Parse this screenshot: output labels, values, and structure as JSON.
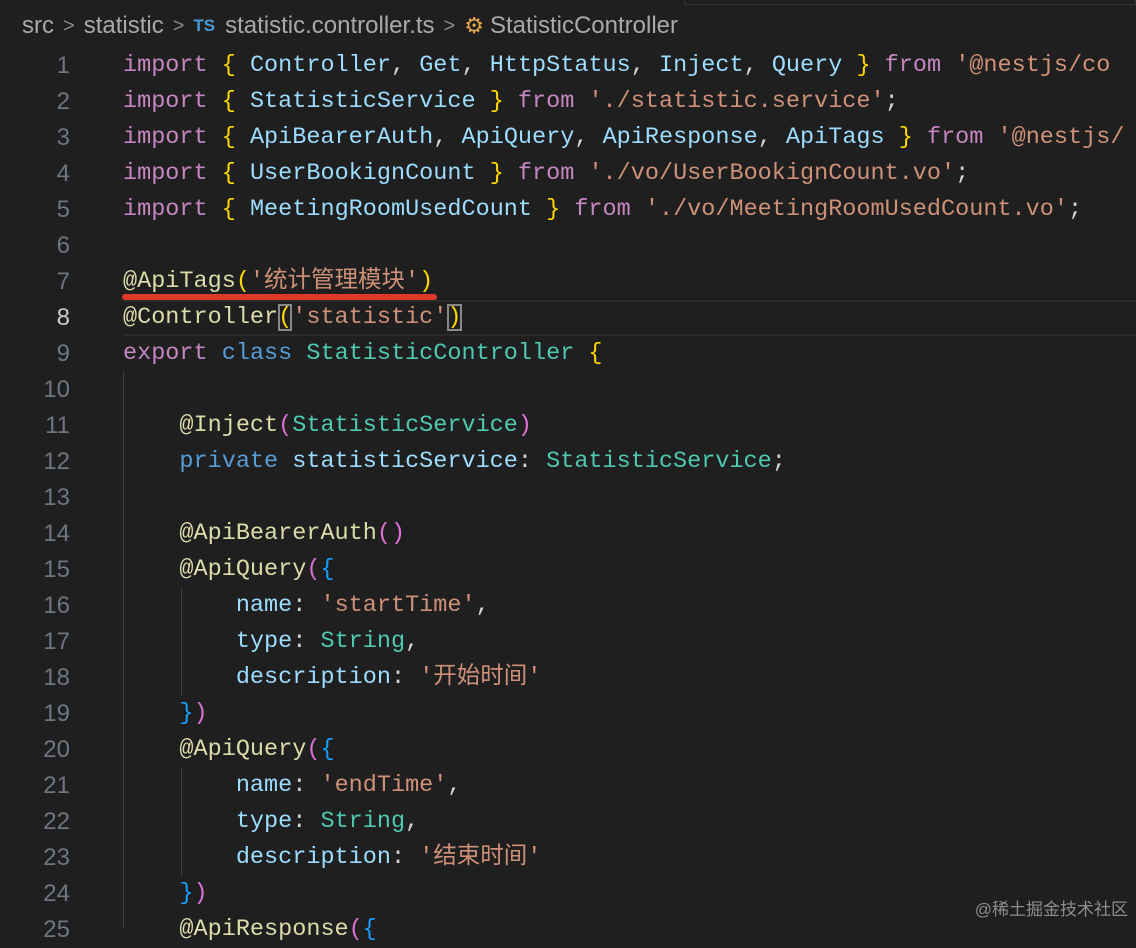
{
  "breadcrumb": {
    "items": [
      "src",
      "statistic",
      "statistic.controller.ts",
      "StatisticController"
    ],
    "file_badge": "TS"
  },
  "active_line": 8,
  "lines": [
    [
      [
        "kw",
        "import"
      ],
      [
        "pl",
        " "
      ],
      [
        "br1",
        "{"
      ],
      [
        "pl",
        " "
      ],
      [
        "var",
        "Controller"
      ],
      [
        "pl",
        ", "
      ],
      [
        "var",
        "Get"
      ],
      [
        "pl",
        ", "
      ],
      [
        "var",
        "HttpStatus"
      ],
      [
        "pl",
        ", "
      ],
      [
        "var",
        "Inject"
      ],
      [
        "pl",
        ", "
      ],
      [
        "var",
        "Query"
      ],
      [
        "pl",
        " "
      ],
      [
        "br1",
        "}"
      ],
      [
        "pl",
        " "
      ],
      [
        "kw",
        "from"
      ],
      [
        "pl",
        " "
      ],
      [
        "str",
        "'@nestjs/co"
      ]
    ],
    [
      [
        "kw",
        "import"
      ],
      [
        "pl",
        " "
      ],
      [
        "br1",
        "{"
      ],
      [
        "pl",
        " "
      ],
      [
        "var",
        "StatisticService"
      ],
      [
        "pl",
        " "
      ],
      [
        "br1",
        "}"
      ],
      [
        "pl",
        " "
      ],
      [
        "kw",
        "from"
      ],
      [
        "pl",
        " "
      ],
      [
        "str",
        "'./statistic.service'"
      ],
      [
        "pl",
        ";"
      ]
    ],
    [
      [
        "kw",
        "import"
      ],
      [
        "pl",
        " "
      ],
      [
        "br1",
        "{"
      ],
      [
        "pl",
        " "
      ],
      [
        "var",
        "ApiBearerAuth"
      ],
      [
        "pl",
        ", "
      ],
      [
        "var",
        "ApiQuery"
      ],
      [
        "pl",
        ", "
      ],
      [
        "var",
        "ApiResponse"
      ],
      [
        "pl",
        ", "
      ],
      [
        "var",
        "ApiTags"
      ],
      [
        "pl",
        " "
      ],
      [
        "br1",
        "}"
      ],
      [
        "pl",
        " "
      ],
      [
        "kw",
        "from"
      ],
      [
        "pl",
        " "
      ],
      [
        "str",
        "'@nestjs/"
      ]
    ],
    [
      [
        "kw",
        "import"
      ],
      [
        "pl",
        " "
      ],
      [
        "br1",
        "{"
      ],
      [
        "pl",
        " "
      ],
      [
        "var",
        "UserBookignCount"
      ],
      [
        "pl",
        " "
      ],
      [
        "br1",
        "}"
      ],
      [
        "pl",
        " "
      ],
      [
        "kw",
        "from"
      ],
      [
        "pl",
        " "
      ],
      [
        "str",
        "'./vo/UserBookignCount.vo'"
      ],
      [
        "pl",
        ";"
      ]
    ],
    [
      [
        "kw",
        "import"
      ],
      [
        "pl",
        " "
      ],
      [
        "br1",
        "{"
      ],
      [
        "pl",
        " "
      ],
      [
        "var",
        "MeetingRoomUsedCount"
      ],
      [
        "pl",
        " "
      ],
      [
        "br1",
        "}"
      ],
      [
        "pl",
        " "
      ],
      [
        "kw",
        "from"
      ],
      [
        "pl",
        " "
      ],
      [
        "str",
        "'./vo/MeetingRoomUsedCount.vo'"
      ],
      [
        "pl",
        ";"
      ]
    ],
    [],
    [
      [
        "fn",
        "@ApiTags"
      ],
      [
        "br1",
        "("
      ],
      [
        "str",
        "'统计管理模块'"
      ],
      [
        "br1",
        ")"
      ]
    ],
    [
      [
        "fn",
        "@Controller"
      ],
      [
        "br1m",
        "("
      ],
      [
        "str",
        "'statistic'"
      ],
      [
        "br1m",
        ")"
      ]
    ],
    [
      [
        "kw",
        "export"
      ],
      [
        "pl",
        " "
      ],
      [
        "kw2",
        "class"
      ],
      [
        "pl",
        " "
      ],
      [
        "cls",
        "StatisticController"
      ],
      [
        "pl",
        " "
      ],
      [
        "br1",
        "{"
      ]
    ],
    [],
    [
      [
        "pl",
        "    "
      ],
      [
        "fn",
        "@Inject"
      ],
      [
        "br2",
        "("
      ],
      [
        "cls",
        "StatisticService"
      ],
      [
        "br2",
        ")"
      ]
    ],
    [
      [
        "pl",
        "    "
      ],
      [
        "kw2",
        "private"
      ],
      [
        "pl",
        " "
      ],
      [
        "var",
        "statisticService"
      ],
      [
        "pl",
        ": "
      ],
      [
        "cls",
        "StatisticService"
      ],
      [
        "pl",
        ";"
      ]
    ],
    [],
    [
      [
        "pl",
        "    "
      ],
      [
        "fn",
        "@ApiBearerAuth"
      ],
      [
        "br2",
        "()"
      ]
    ],
    [
      [
        "pl",
        "    "
      ],
      [
        "fn",
        "@ApiQuery"
      ],
      [
        "br2",
        "("
      ],
      [
        "br3",
        "{"
      ]
    ],
    [
      [
        "pl",
        "        "
      ],
      [
        "var",
        "name"
      ],
      [
        "pl",
        ": "
      ],
      [
        "str",
        "'startTime'"
      ],
      [
        "pl",
        ","
      ]
    ],
    [
      [
        "pl",
        "        "
      ],
      [
        "var",
        "type"
      ],
      [
        "pl",
        ": "
      ],
      [
        "cls",
        "String"
      ],
      [
        "pl",
        ","
      ]
    ],
    [
      [
        "pl",
        "        "
      ],
      [
        "var",
        "description"
      ],
      [
        "pl",
        ": "
      ],
      [
        "str",
        "'开始时间'"
      ]
    ],
    [
      [
        "pl",
        "    "
      ],
      [
        "br3",
        "}"
      ],
      [
        "br2",
        ")"
      ]
    ],
    [
      [
        "pl",
        "    "
      ],
      [
        "fn",
        "@ApiQuery"
      ],
      [
        "br2",
        "("
      ],
      [
        "br3",
        "{"
      ]
    ],
    [
      [
        "pl",
        "        "
      ],
      [
        "var",
        "name"
      ],
      [
        "pl",
        ": "
      ],
      [
        "str",
        "'endTime'"
      ],
      [
        "pl",
        ","
      ]
    ],
    [
      [
        "pl",
        "        "
      ],
      [
        "var",
        "type"
      ],
      [
        "pl",
        ": "
      ],
      [
        "cls",
        "String"
      ],
      [
        "pl",
        ","
      ]
    ],
    [
      [
        "pl",
        "        "
      ],
      [
        "var",
        "description"
      ],
      [
        "pl",
        ": "
      ],
      [
        "str",
        "'结束时间'"
      ]
    ],
    [
      [
        "pl",
        "    "
      ],
      [
        "br3",
        "}"
      ],
      [
        "br2",
        ")"
      ]
    ],
    [
      [
        "pl",
        "    "
      ],
      [
        "fn",
        "@ApiResponse"
      ],
      [
        "br2",
        "("
      ],
      [
        "br3",
        "{"
      ]
    ]
  ],
  "watermark": "@稀土掘金技术社区",
  "colors": {
    "background": "#1f1f1f",
    "keyword": "#c586c0",
    "string": "#ce9178",
    "type": "#4ec9b0",
    "annotation_underline": "#e0392b"
  }
}
